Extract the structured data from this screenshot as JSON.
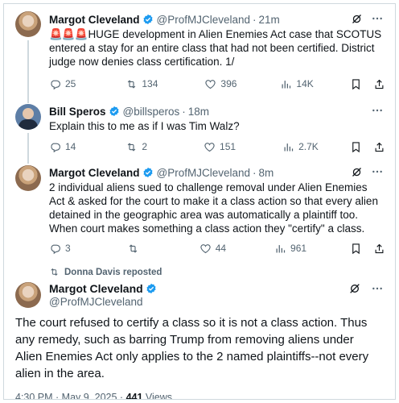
{
  "tweets": [
    {
      "name": "Margot Cleveland",
      "handle": "@ProfMJCleveland",
      "time": "21m",
      "sirens": "🚨🚨🚨",
      "text": "HUGE development in Alien Enemies Act case that SCOTUS entered a stay for an entire class that had not been certified.  District judge now denies class certification. 1/",
      "replies": "25",
      "reposts": "134",
      "likes": "396",
      "views": "14K"
    },
    {
      "name": "Bill Speros",
      "handle": "@billsperos",
      "time": "18m",
      "text": "Explain this to me as if I was Tim Walz?",
      "replies": "14",
      "reposts": "2",
      "likes": "151",
      "views": "2.7K"
    },
    {
      "name": "Margot Cleveland",
      "handle": "@ProfMJCleveland",
      "time": "8m",
      "text": "2 individual aliens sued to challenge removal under Alien Enemies Act & asked for the court to make it a class action so that every alien detained in the geographic area was automatically a plaintiff too. When court makes something a class action they \"certify\" a class.",
      "replies": "3",
      "reposts": "",
      "likes": "44",
      "views": "961"
    }
  ],
  "repost_banner": "Donna Davis reposted",
  "main": {
    "name": "Margot Cleveland",
    "handle": "@ProfMJCleveland",
    "text": "The court refused to certify a class so it is not a class action. Thus any remedy, such as barring Trump from removing aliens under Alien Enemies Act only applies to the 2 named plaintiffs--not every alien in the area.",
    "timestamp": "4:30 PM · May 9, 2025 · ",
    "views_count": "441",
    "views_label": " Views"
  },
  "colors": {
    "verified": "#1d9bf0",
    "secondary": "#536471",
    "text": "#0f1419",
    "siren": "#d6281c"
  },
  "icons": [
    "verified-badge-icon",
    "grok-icon",
    "more-icon",
    "reply-icon",
    "repost-icon",
    "like-icon",
    "views-icon",
    "bookmark-icon",
    "share-icon"
  ]
}
